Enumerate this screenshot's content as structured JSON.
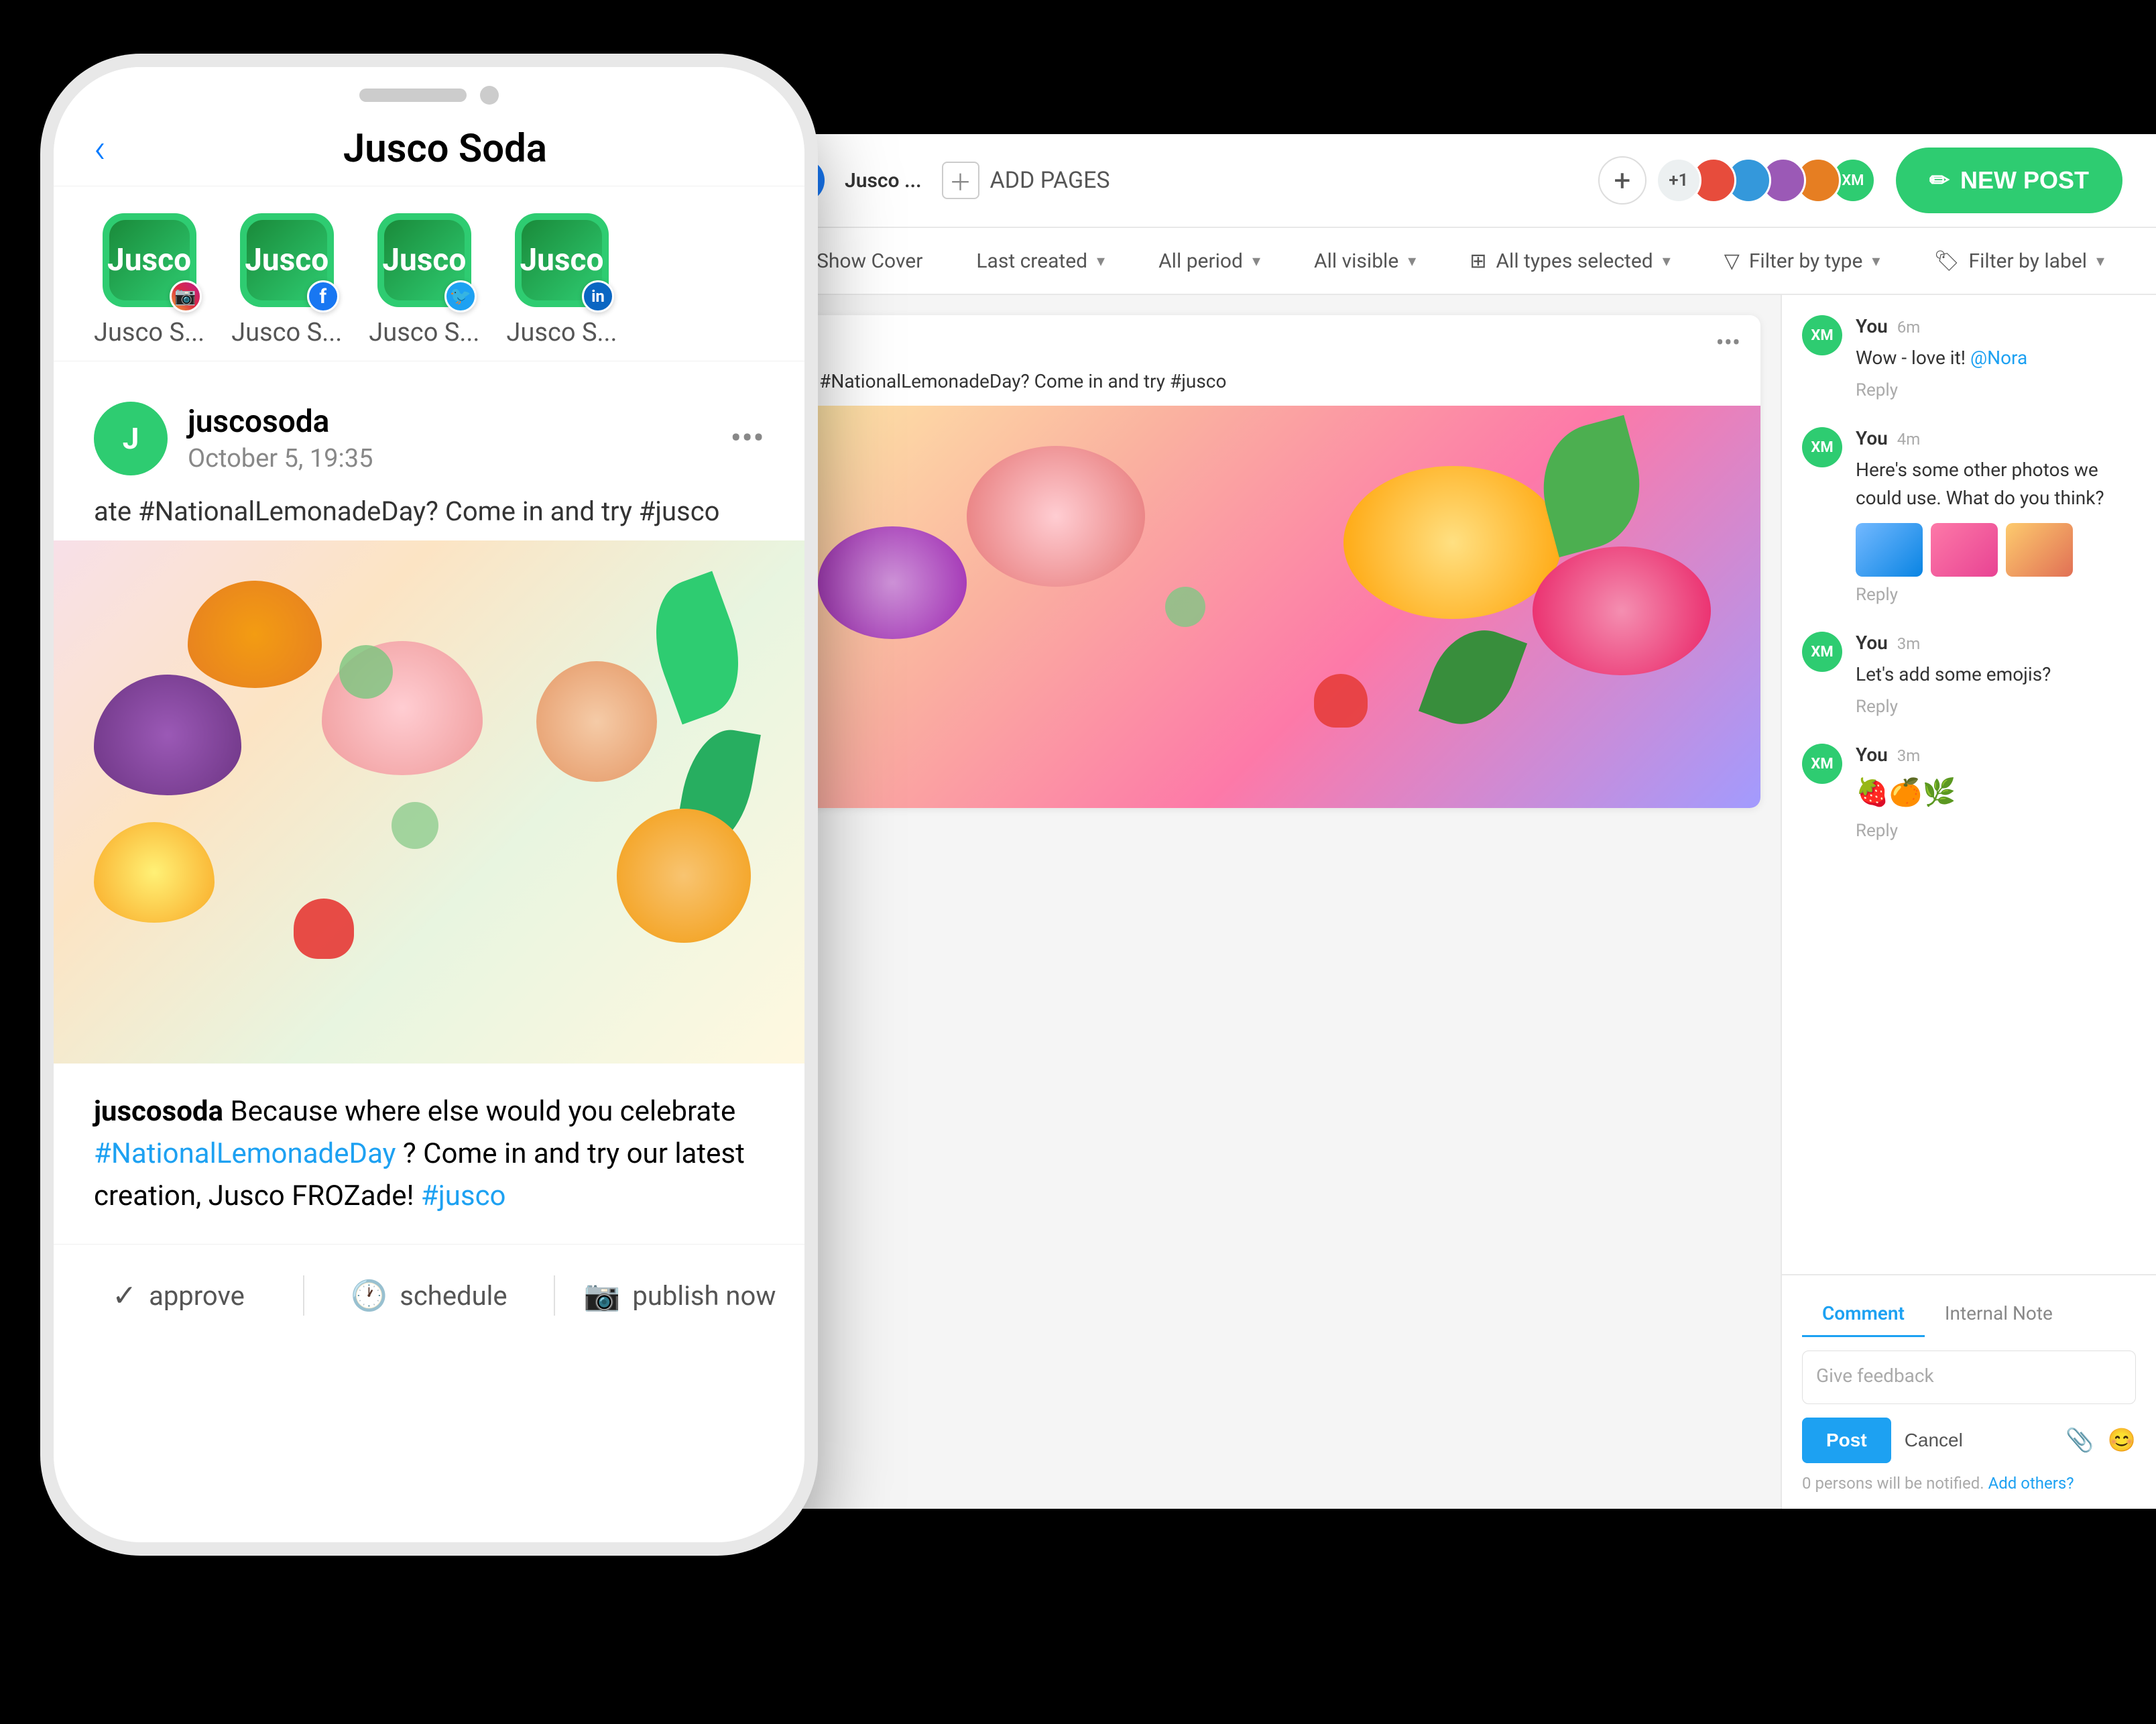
{
  "phone": {
    "title": "Jusco Soda",
    "back_label": "‹",
    "accounts": [
      {
        "label": "Jusco S...",
        "badge": "instagram",
        "badge_symbol": "📷"
      },
      {
        "label": "Jusco S...",
        "badge": "facebook",
        "badge_symbol": "f"
      },
      {
        "label": "Jusco S...",
        "badge": "twitter",
        "badge_symbol": "🐦"
      },
      {
        "label": "Jusco S...",
        "badge": "linkedin",
        "badge_symbol": "in"
      }
    ],
    "post": {
      "username": "juscosoda",
      "timestamp": "October 5, 19:35",
      "text_preview": "ate #NationalLemonadeDay? Come in and try #jusco",
      "caption": "juscosoda Because where else would you celebrate #NationalLemonadeDay? Come in and try our latest creation, Jusco FROZade! #jusco",
      "caption_username": "juscosoda",
      "caption_hashtag1": "#NationalLemonadeDay",
      "caption_hashtag2": "#jusco"
    },
    "actions": {
      "approve": "approve",
      "schedule": "schedule",
      "publish": "publish now"
    }
  },
  "desktop": {
    "header": {
      "page_name": "Jusco ...",
      "add_pages_label": "ADD PAGES",
      "plus_label": "+",
      "avatar_plus": "+1",
      "new_post_label": "NEW POST",
      "new_post_icon": "✏"
    },
    "filters": {
      "show_cover": "Show Cover",
      "last_created": "Last created",
      "all_period": "All period",
      "all_visible": "All visible",
      "all_types": "All types selected",
      "filter_by_type": "Filter by type",
      "filter_by_label": "Filter by label"
    },
    "post_preview": {
      "more_icon": "•••",
      "preview_text": "ate #NationalLemonadeDay? Come in and try #jusco"
    },
    "comments": [
      {
        "author": "You",
        "time": "6m",
        "text": "Wow - love it! @Nora",
        "reply_label": "Reply"
      },
      {
        "author": "You",
        "time": "4m",
        "text": "Here's some other photos we could use. What do you think?",
        "has_images": true,
        "reply_label": "Reply"
      },
      {
        "author": "You",
        "time": "3m",
        "text": "Let's add some emojis?",
        "reply_label": "Reply"
      },
      {
        "author": "You",
        "time": "3m",
        "text": "🍓🍊🌿",
        "reply_label": "Reply"
      }
    ],
    "comment_input": {
      "tab_comment": "Comment",
      "tab_internal_note": "Internal Note",
      "placeholder": "Give feedback",
      "post_btn": "Post",
      "cancel_btn": "Cancel",
      "notify_text": "0 persons will be notified.",
      "add_others_label": "Add others?"
    }
  }
}
